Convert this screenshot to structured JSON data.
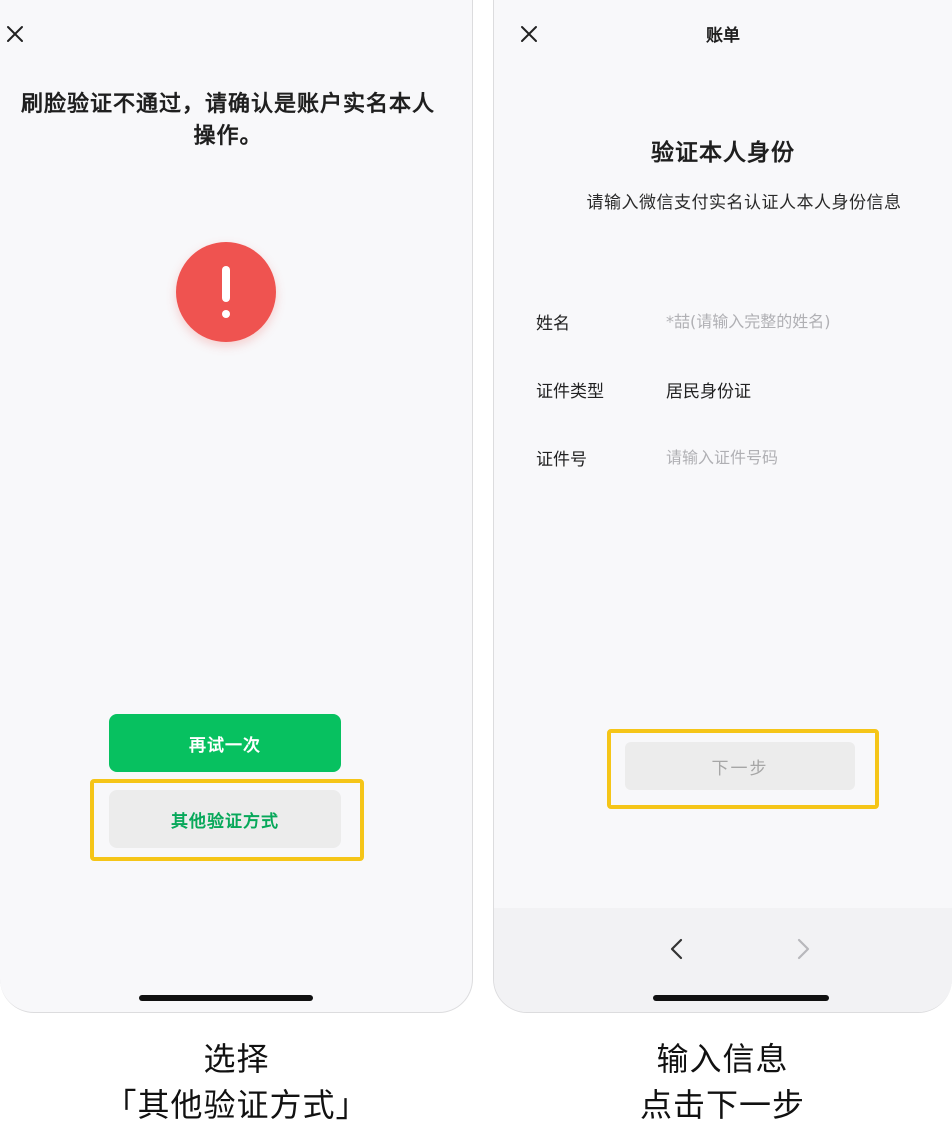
{
  "left_screen": {
    "message": "刷脸验证不通过，请确认是账户实名本人操作。",
    "retry_label": "再试一次",
    "other_method_label": "其他验证方式",
    "close_icon": "close-icon",
    "alert_icon": "exclamation-icon",
    "alert_color": "#ef5350",
    "primary_color": "#07c160",
    "highlight_color": "#f5c518"
  },
  "right_screen": {
    "nav_title": "账单",
    "title": "验证本人身份",
    "subtitle": "请输入微信支付实名认证人本人身份信息",
    "fields": [
      {
        "label": "姓名",
        "value": "",
        "placeholder": "*喆(请输入完整的姓名)"
      },
      {
        "label": "证件类型",
        "value": "居民身份证"
      },
      {
        "label": "证件号",
        "value": "",
        "placeholder": "请输入证件号码"
      }
    ],
    "next_label": "下一步",
    "back_icon": "chevron-left-icon",
    "forward_icon": "chevron-right-icon"
  },
  "captions": {
    "left_line1": "选择",
    "left_line2": "「其他验证方式」",
    "right_line1": "输入信息",
    "right_line2": "点击下一步"
  }
}
